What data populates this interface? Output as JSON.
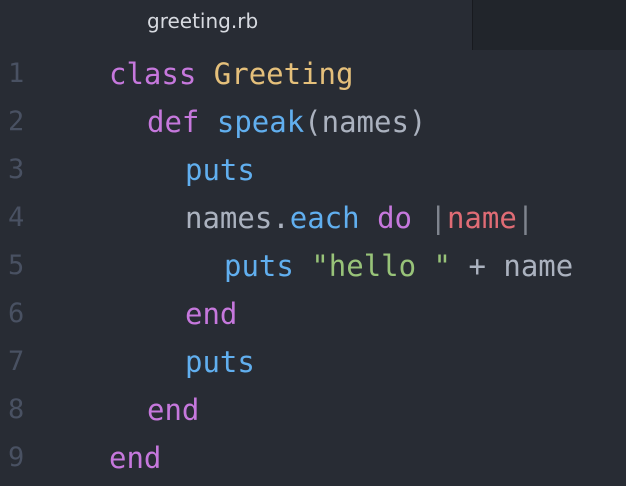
{
  "tab": {
    "title": "greeting.rb"
  },
  "gutter": [
    "1",
    "2",
    "3",
    "4",
    "5",
    "6",
    "7",
    "8",
    "9"
  ],
  "code": {
    "l1": {
      "kw": "class",
      "cls": "Greeting"
    },
    "l2": {
      "kw": "def",
      "fn": "speak",
      "rest": "(names)"
    },
    "l3": {
      "fn": "puts"
    },
    "l4": {
      "obj": "names.",
      "fn": "each",
      "kw": "do",
      "pipe_open": "|",
      "var": "name",
      "pipe_close": "|"
    },
    "l5": {
      "fn": "puts",
      "str": "\"hello \"",
      "rest": "+ name"
    },
    "l6": {
      "kw": "end"
    },
    "l7": {
      "fn": "puts"
    },
    "l8": {
      "kw": "end"
    },
    "l9": {
      "kw": "end"
    }
  },
  "colors": {
    "background": "#282c34",
    "tabbar": "#21252b",
    "keyword": "#c678dd",
    "class_name": "#e5c07b",
    "function": "#61afef",
    "plain": "#abb2bf",
    "variable": "#e06c75",
    "string": "#98c379",
    "gutter_number": "#495162"
  }
}
